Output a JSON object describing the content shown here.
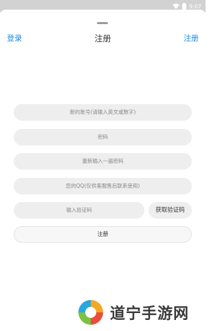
{
  "status": {
    "time": "9:07"
  },
  "header": {
    "login": "登录",
    "title": "注册",
    "register": "注册"
  },
  "form": {
    "account_placeholder": "新的账号(请输入英文或数字)",
    "password_placeholder": "密码",
    "confirm_placeholder": "重新输入一遍密码",
    "qq_placeholder": "您的QQ(仅供客服售后联系使用)",
    "code_placeholder": "输入验证码",
    "get_code_label": "获取验证码",
    "submit_label": "注册"
  },
  "watermark": {
    "text": "道宁手游网"
  },
  "colors": {
    "accent": "#1e88e5",
    "field_bg": "#eeeeef"
  }
}
